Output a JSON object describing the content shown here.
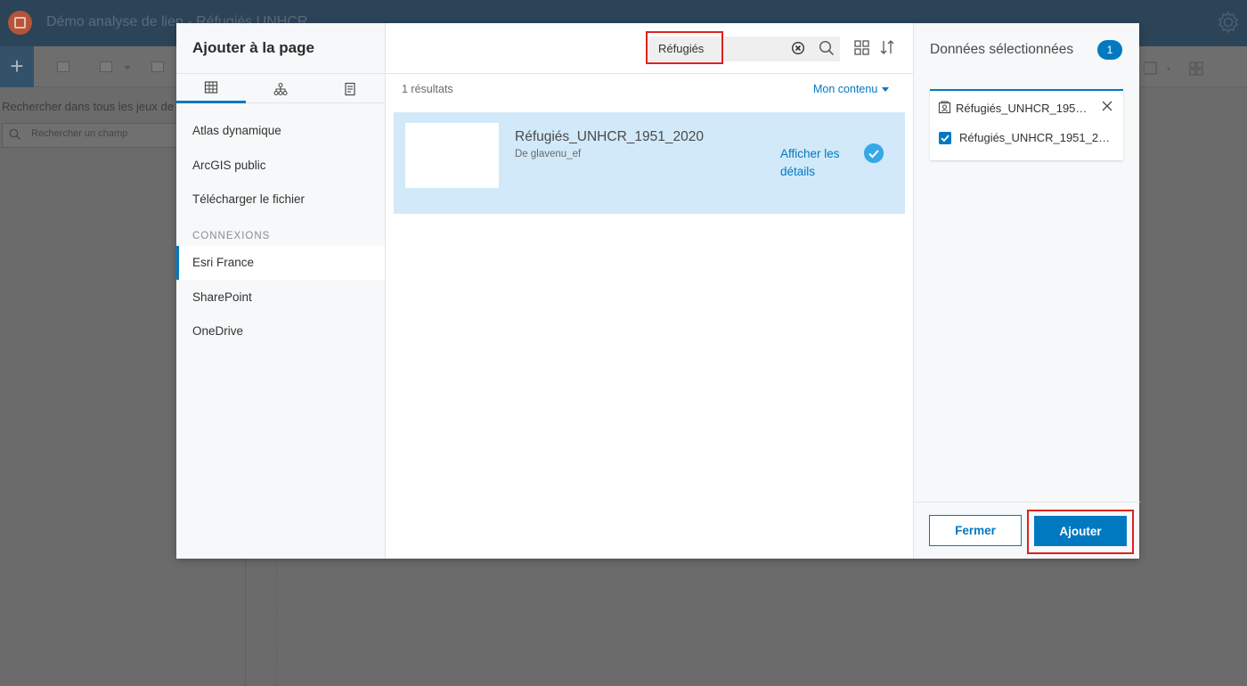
{
  "app": {
    "title": "Démo analyse de lien - Réfugiés UNHCR",
    "left_panel_label": "Rechercher dans tous les jeux de",
    "field_search_placeholder": "Rechercher un champ",
    "add_button_label": "+"
  },
  "dialog": {
    "title": "Ajouter à la page",
    "tabs": [
      {
        "icon": "table-icon"
      },
      {
        "icon": "hierarchy-icon"
      },
      {
        "icon": "document-icon"
      }
    ],
    "sources": [
      "Atlas dynamique",
      "ArcGIS public",
      "Télécharger le fichier"
    ],
    "connections_label": "CONNEXIONS",
    "connections": [
      "Esri France",
      "SharePoint",
      "OneDrive"
    ],
    "search": {
      "value": "Réfugiés"
    },
    "results_count": "1 résultats",
    "content_filter": "Mon contenu",
    "result": {
      "title": "Réfugiés_UNHCR_1951_2020",
      "owner": "De glavenu_ef",
      "details_link": "Afficher les détails",
      "selected": true
    },
    "selection": {
      "title": "Données sélectionnées",
      "count": "1",
      "dataset_name": "Réfugiés_UNHCR_1951_2020",
      "layer_name": "Réfugiés_UNHCR_1951_2020"
    },
    "buttons": {
      "close": "Fermer",
      "add": "Ajouter"
    }
  },
  "colors": {
    "accent": "#0079c1",
    "highlight": "#e0211f",
    "selected_row": "#d2e9f9"
  }
}
